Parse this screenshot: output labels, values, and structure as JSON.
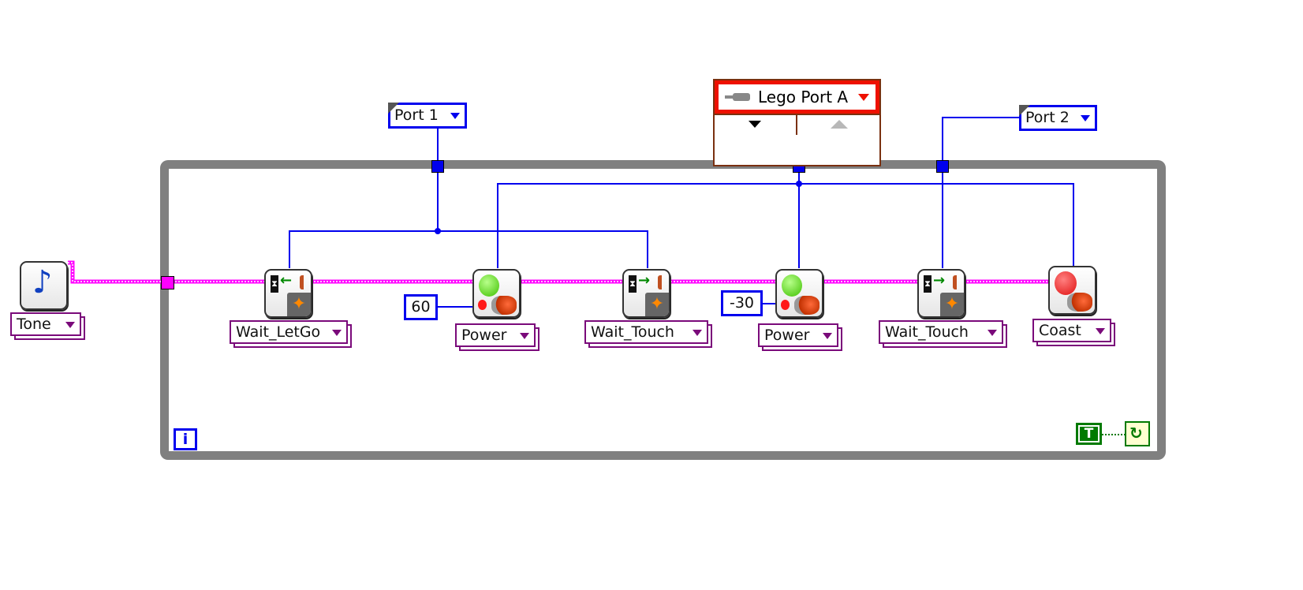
{
  "diagram": {
    "tone_node": {
      "label": "Tone",
      "icon": "music-note-icon"
    },
    "port1": {
      "label": "Port 1"
    },
    "port2": {
      "label": "Port 2"
    },
    "motor_port": {
      "label": "Lego Port A",
      "icon": "connector-icon"
    },
    "nodes": [
      {
        "label": "Wait_LetGo",
        "icon": "wait-letgo-icon"
      },
      {
        "label": "Power",
        "icon": "motor-power-icon",
        "constant": "60"
      },
      {
        "label": "Wait_Touch",
        "icon": "wait-touch-icon"
      },
      {
        "label": "Power",
        "icon": "motor-power-icon",
        "constant": "-30"
      },
      {
        "label": "Wait_Touch",
        "icon": "wait-touch-icon"
      },
      {
        "label": "Coast",
        "icon": "motor-coast-icon"
      }
    ],
    "iteration_terminal": "i",
    "stop_constant": "T",
    "colors": {
      "loop_frame": "#808080",
      "reference_wire": "#0000ee",
      "error_wire": "#ff00ff",
      "ring_border": "#7a0a7a",
      "boolean": "#007a00",
      "motor_ref": "#ee1100"
    }
  }
}
